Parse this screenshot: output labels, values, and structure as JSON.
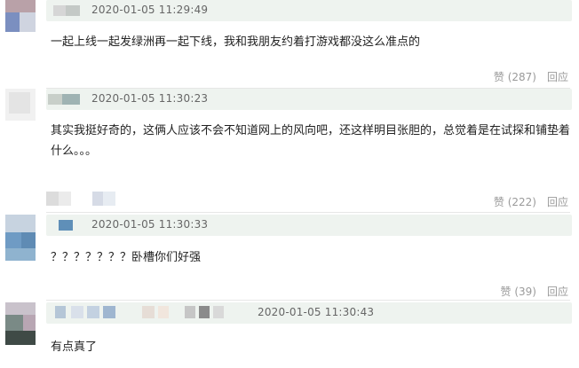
{
  "comments": [
    {
      "timestamp": "2020-01-05 11:29:49",
      "text": "一起上线一起发绿洲再一起下线，我和我朋友约着打游戏都没这么准点的",
      "like_label": "赞 (287)",
      "reply_label": "回应"
    },
    {
      "timestamp": "2020-01-05 11:30:23",
      "text": "其实我挺好奇的，这俩人应该不会不知道网上的风向吧，还这样明目张胆的，总觉着是在试探和铺垫着什么。。。",
      "like_label": "赞 (222)",
      "reply_label": "回应"
    },
    {
      "timestamp": "2020-01-05 11:30:33",
      "text": "？？？？？？？卧槽你们好强",
      "like_label": "赞 (39)",
      "reply_label": "回应"
    },
    {
      "timestamp": "2020-01-05 11:30:43",
      "text": "有点真了"
    }
  ],
  "colors": {
    "meta_bar_bg": "#eef3ef",
    "timestamp": "#666666",
    "action_text": "#9a9a9a",
    "body_text": "#222222"
  }
}
